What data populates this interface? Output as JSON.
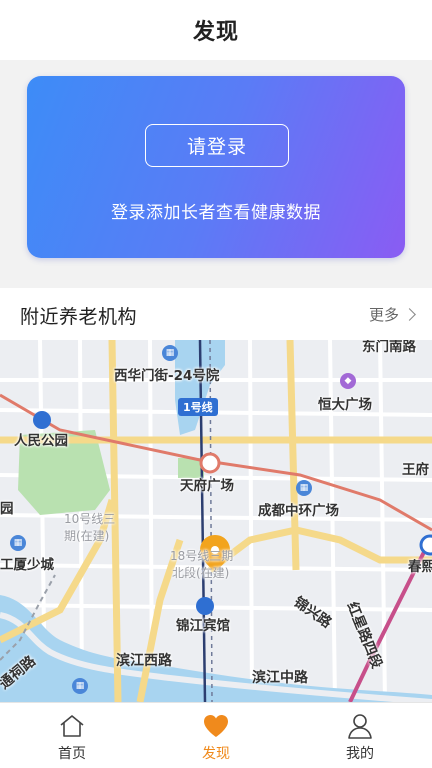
{
  "header": {
    "title": "发现"
  },
  "banner": {
    "login_label": "请登录",
    "subtitle": "登录添加长者查看健康数据",
    "gradient_start": "#3d8cf7",
    "gradient_end": "#8a5cf3"
  },
  "nearby": {
    "title": "附近养老机构",
    "more_label": "更多"
  },
  "map": {
    "labels": {
      "xihua": "西华门街-24号院",
      "line1": "1号线",
      "hengda": "恒大广场",
      "renmin": "人民公园",
      "tianfu": "天府广场",
      "wangfu": "王府",
      "yuan": "园",
      "line10": "10号线三",
      "line10b": "期(在建)",
      "chengdu": "成都中环广场",
      "lianhu": "工厦少城",
      "line18": "18号线三期",
      "line18b": "北段(在建)",
      "chunxi": "春熙",
      "jinjiang": "锦江宾馆",
      "jinxing": "锦兴路",
      "hongxing": "红星路四段",
      "binjiangxi": "滨江西路",
      "binjiangzhong": "滨江中路",
      "tongci": "通祠路",
      "dongnan": "东门南路"
    },
    "colors": {
      "road_major": "#f5d98a",
      "metro_red": "#e07a6a",
      "water": "#a8d4f0",
      "park": "#b9e1b0"
    }
  },
  "tabbar": {
    "items": [
      {
        "label": "首页",
        "icon": "home-icon",
        "active": false
      },
      {
        "label": "发现",
        "icon": "heart-icon",
        "active": true
      },
      {
        "label": "我的",
        "icon": "user-icon",
        "active": false
      }
    ],
    "active_color": "#f08a1c"
  }
}
